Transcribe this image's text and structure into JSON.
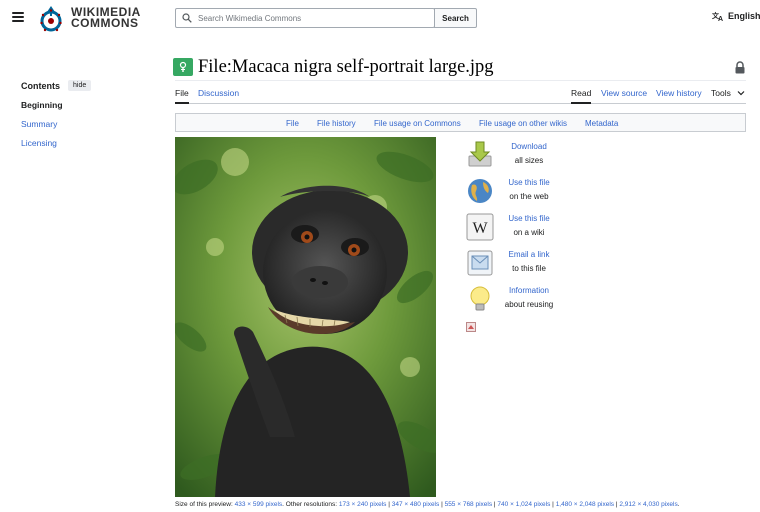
{
  "header": {
    "logo_line1": "WIKIMEDIA",
    "logo_line2": "COMMONS",
    "search_placeholder": "Search Wikimedia Commons",
    "search_button": "Search",
    "language": "English"
  },
  "toc": {
    "title": "Contents",
    "hide": "hide",
    "items": [
      "Beginning",
      "Summary",
      "Licensing"
    ]
  },
  "page": {
    "title": "File:Macaca nigra self-portrait large.jpg"
  },
  "tabs": {
    "left": [
      "File",
      "Discussion"
    ],
    "right": [
      "Read",
      "View source",
      "View history",
      "Tools"
    ]
  },
  "filenav": [
    "File",
    "File history",
    "File usage on Commons",
    "File usage on other wikis",
    "Metadata"
  ],
  "actions": [
    {
      "link": "Download",
      "sub": "all sizes",
      "icon": "download-icon"
    },
    {
      "link": "Use this file",
      "sub": "on the web",
      "icon": "globe-icon"
    },
    {
      "link": "Use this file",
      "sub": "on a wiki",
      "icon": "wikipedia-icon"
    },
    {
      "link": "Email a link",
      "sub": "to this file",
      "icon": "email-icon"
    },
    {
      "link": "Information",
      "sub": "about reusing",
      "icon": "lightbulb-icon"
    }
  ],
  "footnote": {
    "prefix": "Size of this preview:",
    "preview": "433 × 599 pixels",
    "middle": ". Other resolutions:",
    "resolutions": [
      "173 × 240 pixels",
      "347 × 480 pixels",
      "555 × 768 pixels",
      "740 × 1,024 pixels",
      "1,480 × 2,048 pixels",
      "2,912 × 4,030 pixels"
    ],
    "end": "."
  }
}
